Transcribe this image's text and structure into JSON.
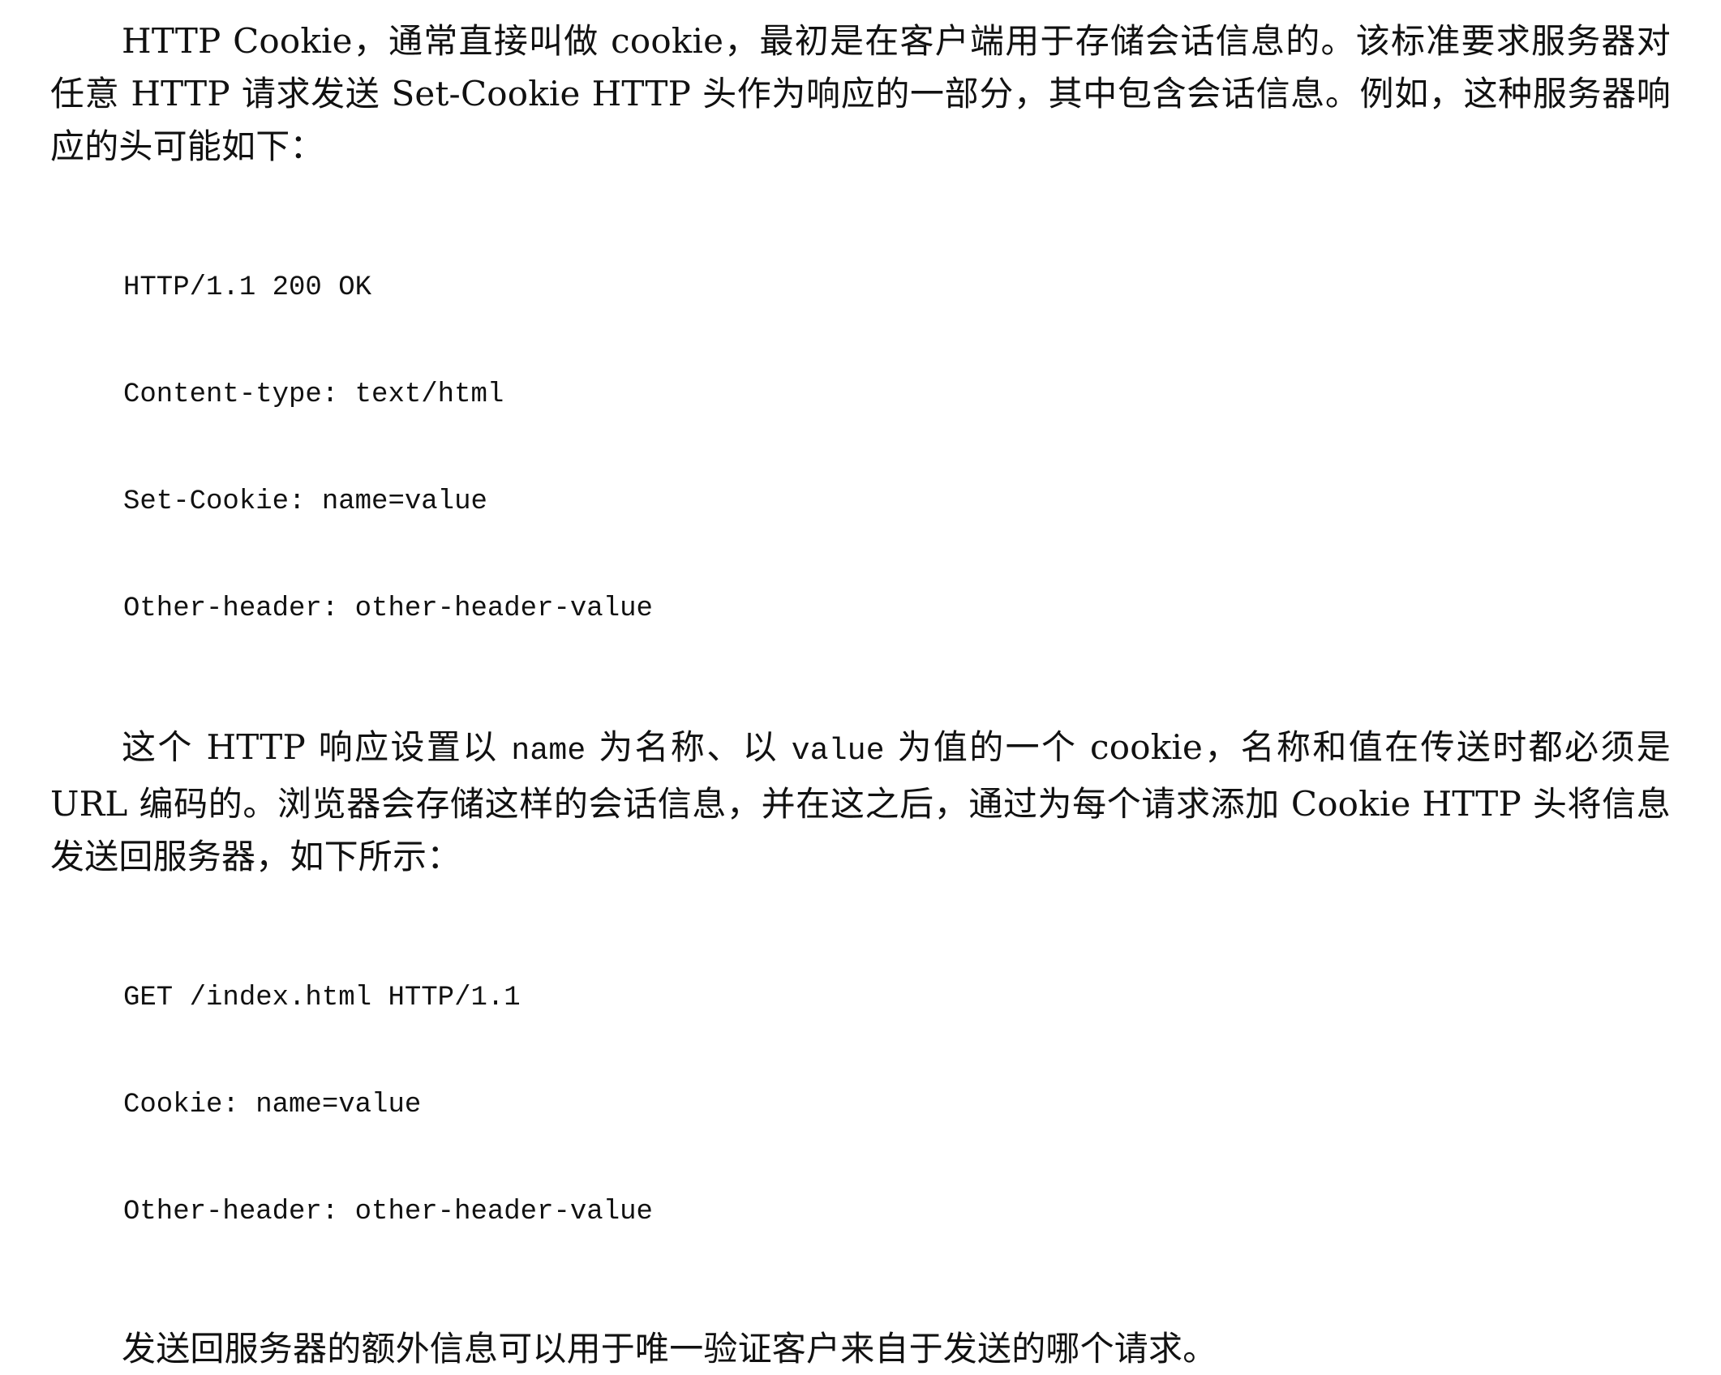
{
  "paragraphs": {
    "p1": "HTTP Cookie，通常直接叫做 cookie，最初是在客户端用于存储会话信息的。该标准要求服务器对任意 HTTP 请求发送 Set-Cookie HTTP 头作为响应的一部分，其中包含会话信息。例如，这种服务器响应的头可能如下：",
    "p2_part1": "这个 HTTP 响应设置以 ",
    "p2_code1": "name",
    "p2_part2": " 为名称、以 ",
    "p2_code2": "value",
    "p2_part3": " 为值的一个 cookie，名称和值在传送时都必须是 URL 编码的。浏览器会存储这样的会话信息，并在这之后，通过为每个请求添加 Cookie HTTP 头将信息发送回服务器，如下所示：",
    "p3": "发送回服务器的额外信息可以用于唯一验证客户来自于发送的哪个请求。"
  },
  "code_blocks": {
    "response": [
      "HTTP/1.1 200 OK",
      "Content-type: text/html",
      "Set-Cookie: name=value",
      "Other-header: other-header-value"
    ],
    "request": [
      "GET /index.html HTTP/1.1",
      "Cookie: name=value",
      "Other-header: other-header-value"
    ]
  }
}
